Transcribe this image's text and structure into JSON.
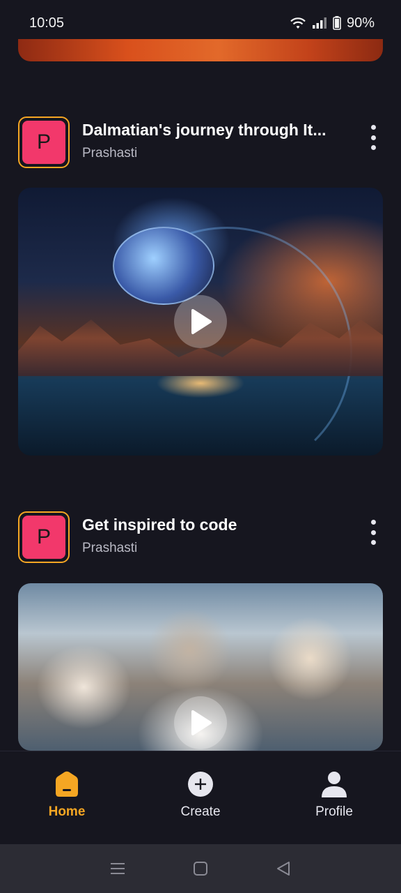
{
  "status_bar": {
    "time": "10:05",
    "battery": "90%",
    "icons": [
      "wifi-icon",
      "signal-icon",
      "battery-icon"
    ]
  },
  "feed": {
    "posts": [
      {
        "title": "Dalmatian's journey through It...",
        "author": "Prashasti",
        "avatar_letter": "P",
        "media": "space-landscape-video"
      },
      {
        "title": "Get inspired to code",
        "author": "Prashasti",
        "avatar_letter": "P",
        "media": "cats-selfie-video"
      }
    ]
  },
  "bottom_nav": {
    "items": [
      {
        "label": "Home",
        "icon": "home-icon",
        "active": true
      },
      {
        "label": "Create",
        "icon": "plus-circle-icon",
        "active": false
      },
      {
        "label": "Profile",
        "icon": "person-icon",
        "active": false
      }
    ]
  },
  "colors": {
    "background": "#16161f",
    "accent": "#f5a623",
    "avatar": "#f2386b",
    "system_nav": "#2c2c34"
  }
}
